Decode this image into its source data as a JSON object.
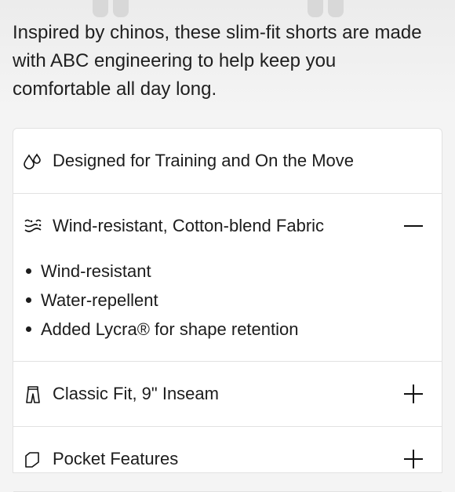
{
  "product": {
    "description": "Inspired by chinos, these slim-fit shorts are made with ABC engineering to help keep you comfortable all day long."
  },
  "features": [
    {
      "label": "Designed for Training and On the Move",
      "icon": "drops-icon"
    },
    {
      "label": "Wind-resistant, Cotton-blend Fabric",
      "icon": "wind-fabric-icon",
      "state": "expanded",
      "toggle": "minus-icon",
      "bullets": [
        "Wind-resistant",
        "Water-repellent",
        "Added Lycra® for shape retention"
      ]
    },
    {
      "label": "Classic Fit, 9\" Inseam",
      "icon": "shorts-icon",
      "state": "collapsed",
      "toggle": "plus-icon"
    },
    {
      "label": "Pocket Features",
      "icon": "pocket-icon",
      "state": "collapsed",
      "toggle": "plus-icon"
    }
  ]
}
